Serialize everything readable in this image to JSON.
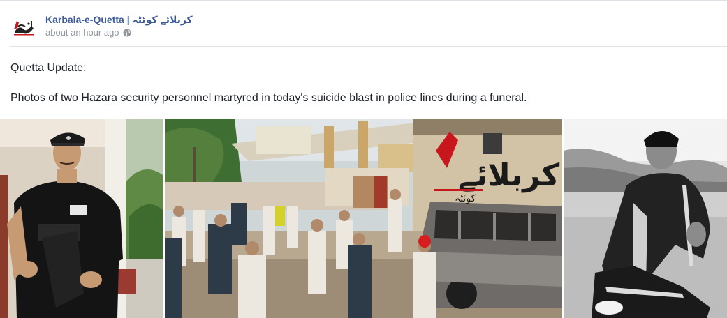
{
  "post": {
    "page_name": "Karbala-e-Quetta | کربلائے کوئٹہ",
    "timestamp": "about an hour ago",
    "privacy_icon": "globe-icon",
    "text_line_1": "Quetta Update:",
    "text_line_2": "Photos of two Hazara security personnel martyred in today's suicide blast in police lines during a funeral."
  },
  "photos": {
    "middle_watermark": "کربلائے",
    "middle_watermark_sub": "کوئٹہ"
  },
  "colors": {
    "link": "#3b5998",
    "meta": "#90949c",
    "watermark_red": "#c8161d"
  }
}
